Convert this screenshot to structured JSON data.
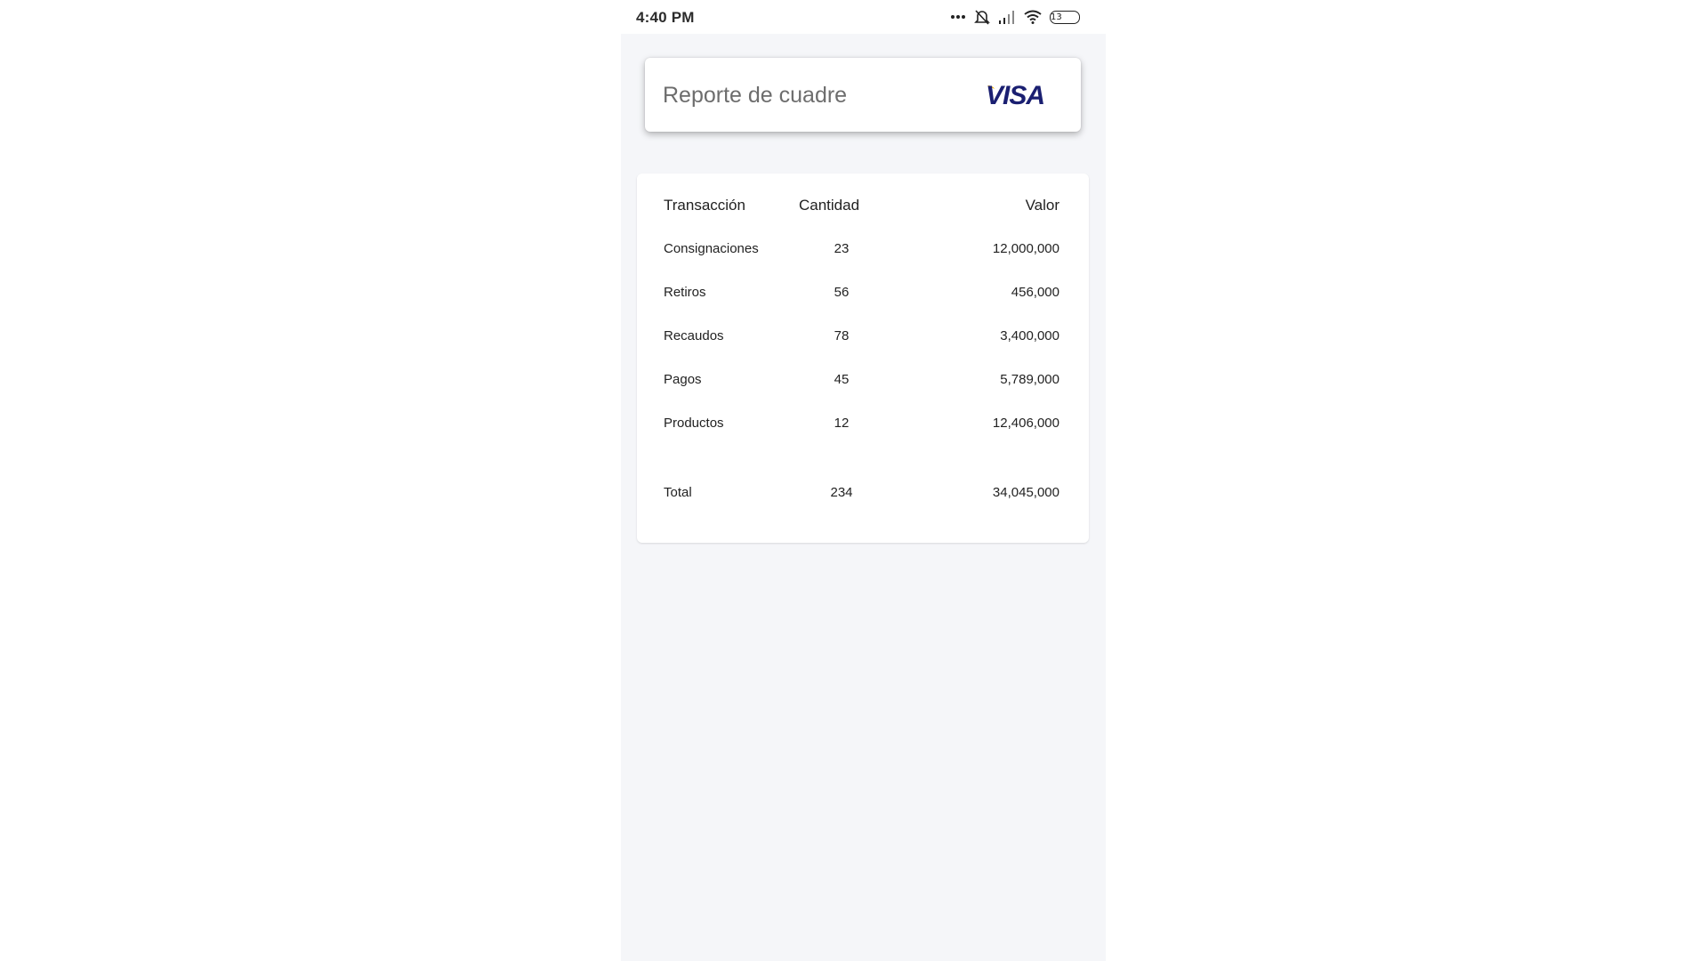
{
  "status_bar": {
    "time": "4:40 PM",
    "battery_level": "13",
    "icons": [
      "more-dots-icon",
      "alarm-off-icon",
      "signal-icon",
      "wifi-icon",
      "battery-icon"
    ]
  },
  "header": {
    "title": "Reporte de cuadre",
    "logo_text": "VISA"
  },
  "table": {
    "columns": [
      "Transacción",
      "Cantidad",
      "Valor"
    ],
    "rows": [
      {
        "name": "Consignaciones",
        "qty": "23",
        "value": "12,000,000"
      },
      {
        "name": "Retiros",
        "qty": "56",
        "value": "456,000"
      },
      {
        "name": "Recaudos",
        "qty": "78",
        "value": "3,400,000"
      },
      {
        "name": "Pagos",
        "qty": "45",
        "value": "5,789,000"
      },
      {
        "name": "Productos",
        "qty": "12",
        "value": "12,406,000"
      }
    ],
    "total": {
      "name": "Total",
      "qty": "234",
      "value": "34,045,000"
    }
  },
  "colors": {
    "screen_background": "#f5f6f9",
    "card_background": "#ffffff",
    "visa_blue": "#1a1f71",
    "visa_gold": "#f7b600"
  }
}
